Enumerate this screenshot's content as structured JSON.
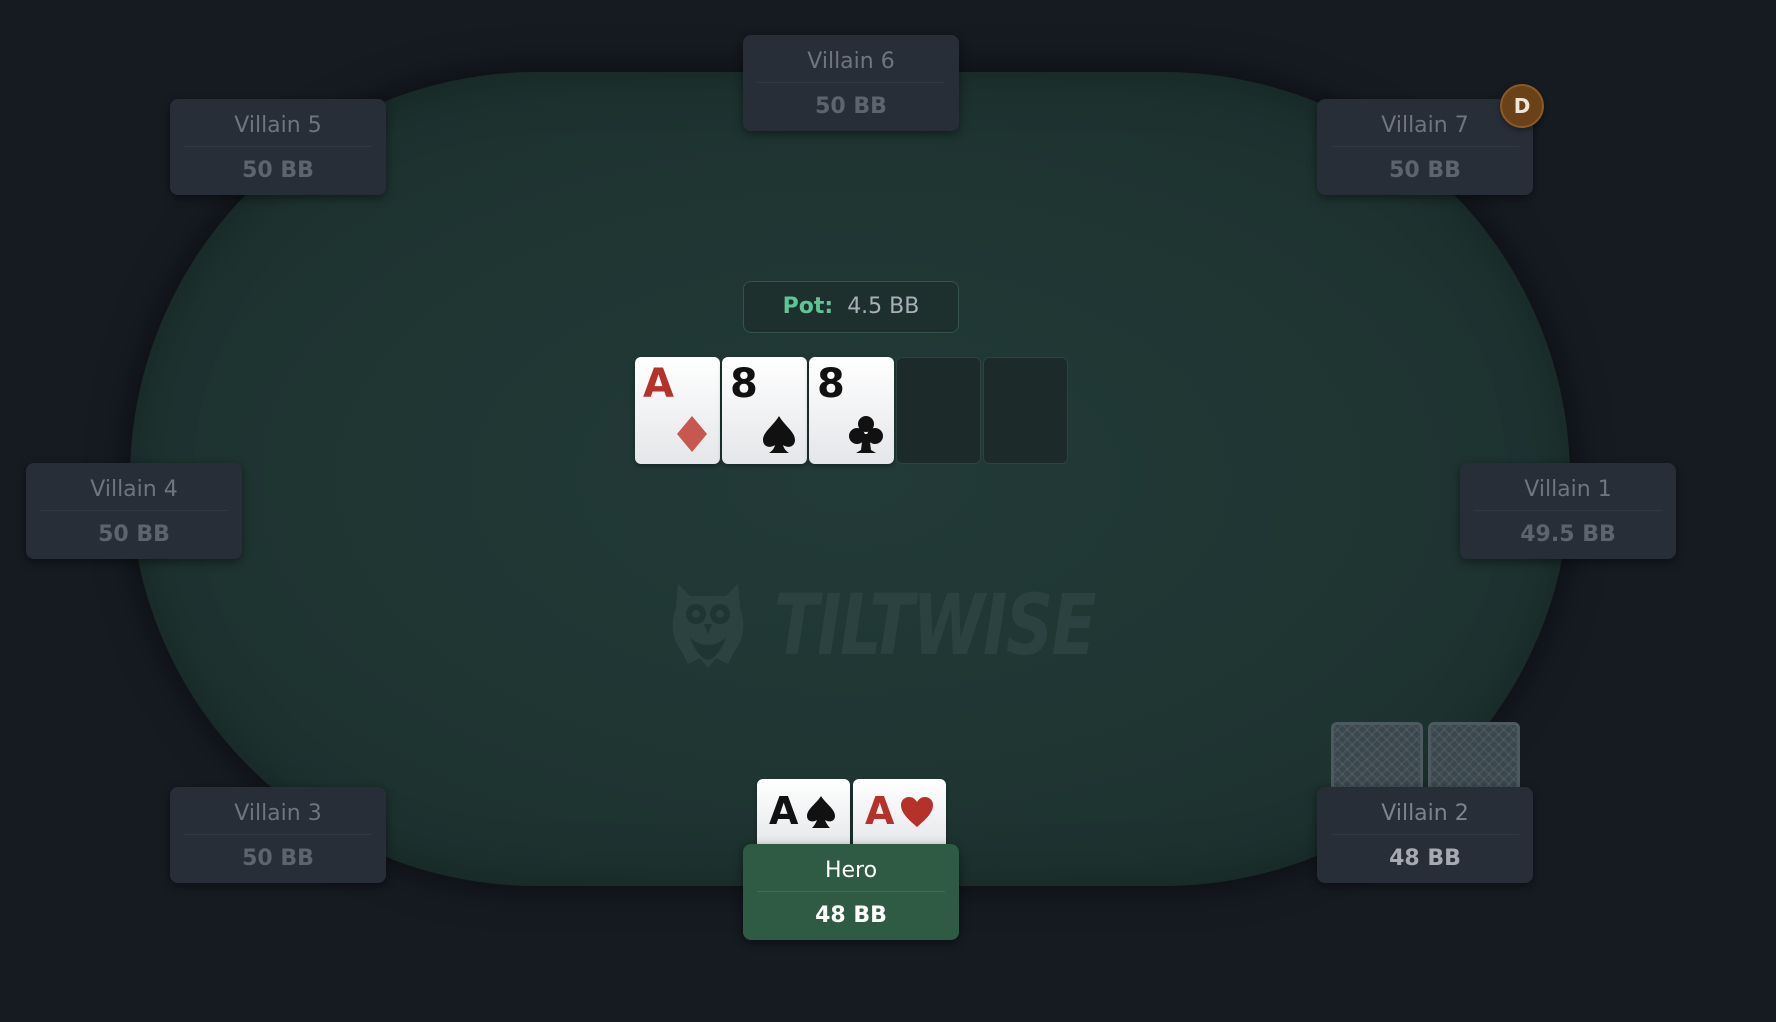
{
  "table": {
    "logo_text": "TILTWISE",
    "logo_tm": "™",
    "pot": {
      "label": "Pot:",
      "value": "4.5 BB"
    },
    "board": [
      {
        "rank": "A",
        "suit": "diamond",
        "color": "#c8574f"
      },
      {
        "rank": "8",
        "suit": "spade",
        "color": "#111111"
      },
      {
        "rank": "8",
        "suit": "club",
        "color": "#111111"
      },
      {
        "rank": "",
        "suit": "",
        "color": ""
      },
      {
        "rank": "",
        "suit": "",
        "color": ""
      }
    ],
    "dealer_label": "D"
  },
  "seats": {
    "villain6": {
      "name": "Villain 6",
      "stack": "50 BB"
    },
    "villain5": {
      "name": "Villain 5",
      "stack": "50 BB"
    },
    "villain7": {
      "name": "Villain 7",
      "stack": "50 BB"
    },
    "villain4": {
      "name": "Villain 4",
      "stack": "50 BB"
    },
    "villain1": {
      "name": "Villain 1",
      "stack": "49.5 BB"
    },
    "villain3": {
      "name": "Villain 3",
      "stack": "50 BB"
    },
    "villain2": {
      "name": "Villain 2",
      "stack": "48 BB"
    },
    "hero": {
      "name": "Hero",
      "stack": "48 BB"
    }
  },
  "hero_cards": [
    {
      "rank": "A",
      "suit": "spade",
      "color": "#111111"
    },
    {
      "rank": "A",
      "suit": "heart",
      "color": "#b5322b"
    }
  ],
  "colors": {
    "background": "#161b22",
    "felt": "#1f3532",
    "seat": "#282e37",
    "hero_seat": "#2f5a43",
    "pot_label": "#5fc596",
    "dealer": "#6b4218"
  }
}
